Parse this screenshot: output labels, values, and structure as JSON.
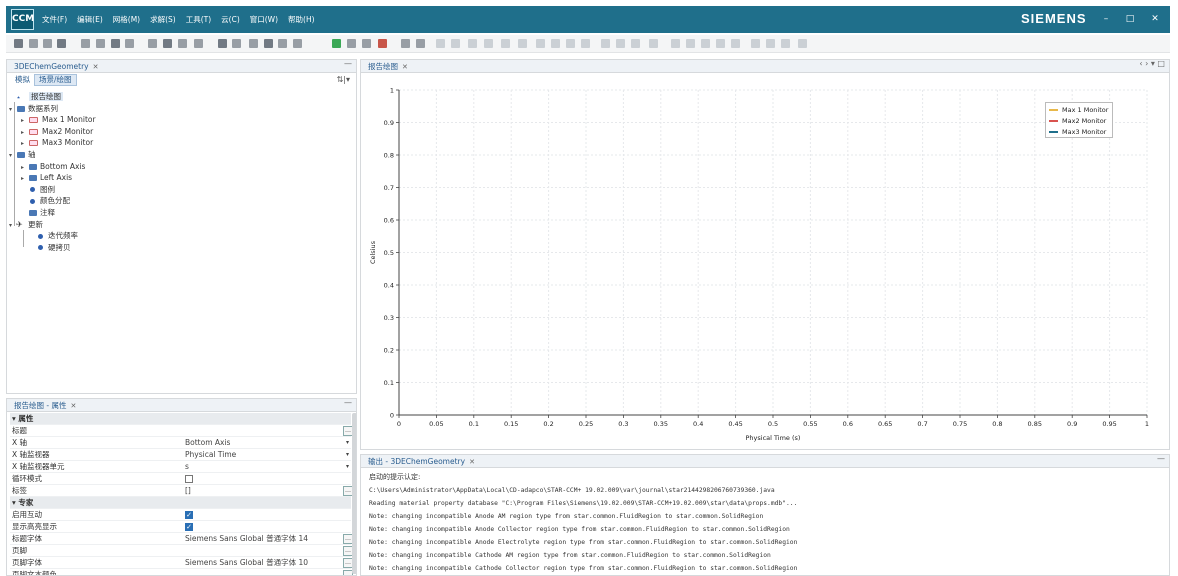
{
  "app": {
    "logo_text": "CCM",
    "menu": [
      "文件(F)",
      "编辑(E)",
      "网格(M)",
      "求解(S)",
      "工具(T)",
      "云(C)",
      "窗口(W)",
      "帮助(H)"
    ],
    "brand": "SIEMENS",
    "window_buttons": {
      "minimize": "–",
      "maximize": "□",
      "close": "✕"
    }
  },
  "toolbar": {
    "icons": [
      "new-file-icon",
      "open-icon",
      "save-icon",
      "save-all-icon",
      "copy-icon",
      "paste-icon",
      "undo-icon",
      "redo-icon",
      "run-icon",
      "step-icon",
      "pause-icon",
      "stop-icon",
      "mesh-icon",
      "geometry-icon",
      "scene-icon",
      "plot-icon",
      "table-icon",
      "monitor-icon",
      "flag-icon",
      "walk-icon",
      "run-man-icon",
      "stop-solver-icon",
      "view-icon",
      "settings-icon"
    ],
    "colors": {
      "flag": "#1a9a3a",
      "stop": "#c0392b",
      "default": "#5a6470"
    }
  },
  "tree_panel": {
    "tab_label": "3DEChemGeometry",
    "tab_close": "✕",
    "minimize": "—",
    "subtabs": [
      "模拟",
      "场景/绘图"
    ],
    "active_subtab": "场景/绘图",
    "tool_icon": "⇅|▾",
    "rows": [
      {
        "label": "报告绘图",
        "icon": "plot-icon",
        "expander": ""
      },
      {
        "label": "数据系列",
        "icon": "folder-icon",
        "expander": "▾"
      },
      {
        "label": "Max 1 Monitor",
        "icon": "monitor-icon",
        "expander": "▸"
      },
      {
        "label": "Max2 Monitor",
        "icon": "monitor-icon",
        "expander": "▸"
      },
      {
        "label": "Max3 Monitor",
        "icon": "monitor-icon",
        "expander": "▸"
      },
      {
        "label": "轴",
        "icon": "folder-icon",
        "expander": "▾"
      },
      {
        "label": "Bottom Axis",
        "icon": "folder-icon",
        "expander": "▸"
      },
      {
        "label": "Left Axis",
        "icon": "folder-icon",
        "expander": "▸"
      },
      {
        "label": "图例",
        "icon": "dot-icon",
        "expander": ""
      },
      {
        "label": "颜色分配",
        "icon": "dot-icon",
        "expander": ""
      },
      {
        "label": "注释",
        "icon": "folder-icon",
        "expander": ""
      },
      {
        "label": "更新",
        "icon": "update-icon",
        "expander": "▾"
      },
      {
        "label": "迭代频率",
        "icon": "dot-icon",
        "expander": ""
      },
      {
        "label": "硬拷贝",
        "icon": "dot-icon",
        "expander": ""
      }
    ]
  },
  "props_panel": {
    "tab_label": "报告绘图 - 属性",
    "tab_close": "✕",
    "minimize": "—",
    "rows": [
      {
        "kind": "cat",
        "name": "▾ 属性"
      },
      {
        "kind": "prop",
        "name": "标题",
        "value": "",
        "control": "button"
      },
      {
        "kind": "prop",
        "name": "X 轴",
        "value": "Bottom Axis",
        "control": "dropdown"
      },
      {
        "kind": "prop",
        "name": "X 轴监视器",
        "value": "Physical Time",
        "control": "dropdown"
      },
      {
        "kind": "prop",
        "name": "X 轴监视器单元",
        "value": "s",
        "control": "dropdown"
      },
      {
        "kind": "prop",
        "name": "循环模式",
        "value": "",
        "control": "checkbox",
        "checked": false
      },
      {
        "kind": "prop",
        "name": "标签",
        "value": "[]",
        "control": "button"
      },
      {
        "kind": "cat",
        "name": "▾ 专家"
      },
      {
        "kind": "prop",
        "name": "启用互动",
        "value": "",
        "control": "checkbox",
        "checked": true
      },
      {
        "kind": "prop",
        "name": "显示高亮显示",
        "value": "",
        "control": "checkbox",
        "checked": true
      },
      {
        "kind": "prop",
        "name": "标题字体",
        "value": "Siemens Sans Global 普通字体 14",
        "control": "button"
      },
      {
        "kind": "prop",
        "name": "页脚",
        "value": "",
        "control": "button"
      },
      {
        "kind": "prop",
        "name": "页脚字体",
        "value": "Siemens Sans Global 普通字体 10",
        "control": "button"
      },
      {
        "kind": "prop",
        "name": "页脚文本颜色",
        "value": "",
        "control": "button"
      }
    ],
    "button_glyph": "…",
    "dropdown_glyph": "▾",
    "check_glyph": "✓"
  },
  "plot_panel": {
    "tab_label": "报告绘图",
    "tab_close": "✕",
    "nav": "‹ › ▾ □"
  },
  "chart_data": {
    "type": "line",
    "title": "",
    "xlabel": "Physical Time (s)",
    "ylabel": "Celsius",
    "xlim": [
      0,
      1
    ],
    "ylim": [
      0,
      1
    ],
    "xticks": [
      "0",
      "0.05",
      "0.1",
      "0.15",
      "0.2",
      "0.25",
      "0.3",
      "0.35",
      "0.4",
      "0.45",
      "0.5",
      "0.55",
      "0.6",
      "0.65",
      "0.7",
      "0.75",
      "0.8",
      "0.85",
      "0.9",
      "0.95",
      "1"
    ],
    "yticks": [
      "0",
      "0.1",
      "0.2",
      "0.3",
      "0.4",
      "0.5",
      "0.6",
      "0.7",
      "0.8",
      "0.9",
      "1"
    ],
    "grid": true,
    "legend_position": "top-right",
    "series": [
      {
        "name": "Max 1 Monitor",
        "color": "#e8b84a",
        "x": [],
        "y": []
      },
      {
        "name": "Max2 Monitor",
        "color": "#d9534f",
        "x": [],
        "y": []
      },
      {
        "name": "Max3 Monitor",
        "color": "#1f6f8b",
        "x": [],
        "y": []
      }
    ]
  },
  "output_panel": {
    "tab_label": "输出 - 3DEChemGeometry",
    "tab_close": "✕",
    "minimize": "—",
    "lines": [
      "启动的提示认定:",
      "C:\\Users\\Administrator\\AppData\\Local\\CD-adapco\\STAR-CCM+ 19.02.009\\var\\journal\\star2144298206760739360.java",
      "Reading material property database \"C:\\Program Files\\Siemens\\19.02.009\\STAR-CCM+19.02.009\\star\\data\\props.mdb\"...",
      "Note: changing incompatible Anode AM region type from star.common.FluidRegion to star.common.SolidRegion",
      "Note: changing incompatible Anode Collector region type from star.common.FluidRegion to star.common.SolidRegion",
      "Note: changing incompatible Anode Electrolyte region type from star.common.FluidRegion to star.common.SolidRegion",
      "Note: changing incompatible Cathode AM region type from star.common.FluidRegion to star.common.SolidRegion",
      "Note: changing incompatible Cathode Collector region type from star.common.FluidRegion to star.common.SolidRegion",
      "Note: changing incompatible Cathode Electrolyte region type from star.common.FluidRegion to star.common.SolidRegion"
    ]
  }
}
